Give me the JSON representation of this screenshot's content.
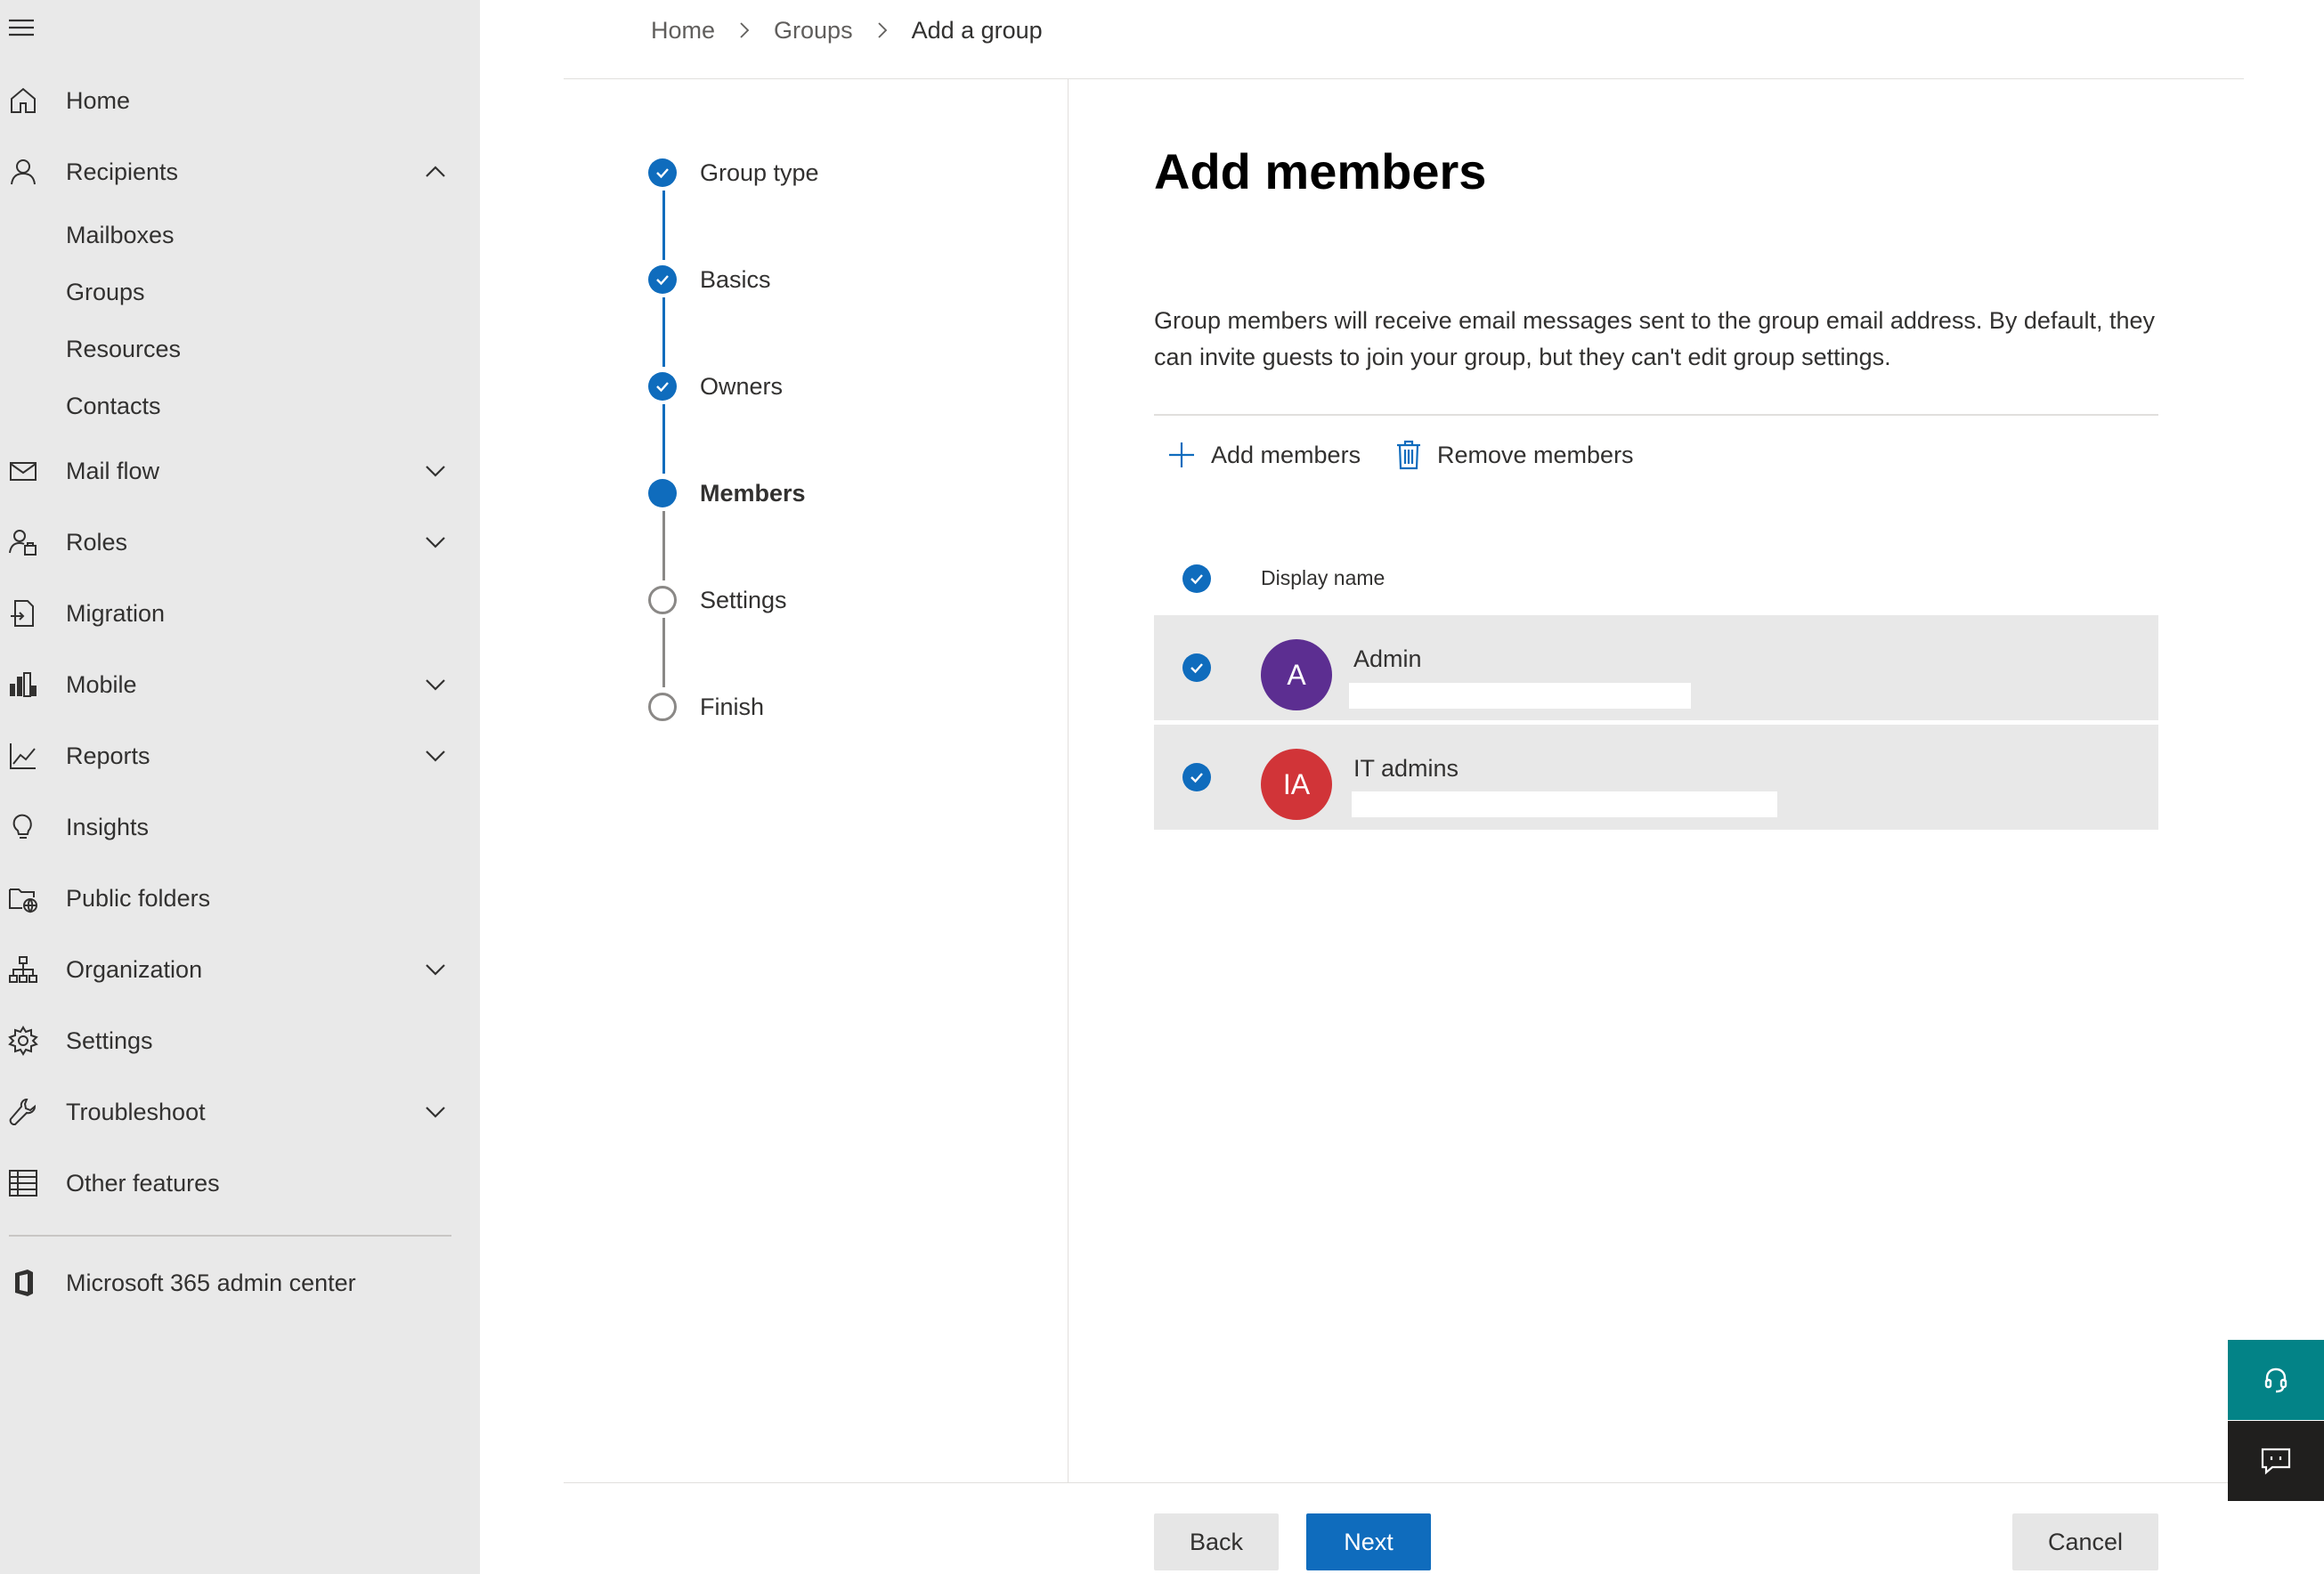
{
  "breadcrumb": {
    "items": [
      "Home",
      "Groups",
      "Add a group"
    ]
  },
  "sidebar": {
    "items": [
      {
        "label": "Home",
        "icon": "home-icon"
      },
      {
        "label": "Recipients",
        "icon": "person-icon",
        "expanded": true,
        "children": [
          "Mailboxes",
          "Groups",
          "Resources",
          "Contacts"
        ]
      },
      {
        "label": "Mail flow",
        "icon": "mail-icon"
      },
      {
        "label": "Roles",
        "icon": "roles-icon"
      },
      {
        "label": "Migration",
        "icon": "migration-icon"
      },
      {
        "label": "Mobile",
        "icon": "mobile-icon"
      },
      {
        "label": "Reports",
        "icon": "reports-icon"
      },
      {
        "label": "Insights",
        "icon": "lightbulb-icon"
      },
      {
        "label": "Public folders",
        "icon": "public-folder-icon"
      },
      {
        "label": "Organization",
        "icon": "organization-icon"
      },
      {
        "label": "Settings",
        "icon": "gear-icon"
      },
      {
        "label": "Troubleshoot",
        "icon": "wrench-icon"
      },
      {
        "label": "Other features",
        "icon": "table-icon"
      }
    ],
    "footer_link": "Microsoft 365 admin center"
  },
  "wizard": {
    "steps": [
      {
        "label": "Group type",
        "status": "done"
      },
      {
        "label": "Basics",
        "status": "done"
      },
      {
        "label": "Owners",
        "status": "done"
      },
      {
        "label": "Members",
        "status": "current"
      },
      {
        "label": "Settings",
        "status": "todo"
      },
      {
        "label": "Finish",
        "status": "todo"
      }
    ]
  },
  "main": {
    "title": "Add members",
    "description": "Group members will receive email messages sent to the group email address. By default, they can invite guests to join your group, but they can't edit group settings.",
    "add_members_label": "Add members",
    "remove_members_label": "Remove members",
    "column_header": "Display name",
    "members": [
      {
        "initials": "A",
        "name": "Admin",
        "avatar_color": "#5c2e91",
        "selected": true
      },
      {
        "initials": "IA",
        "name": "IT admins",
        "avatar_color": "#d13438",
        "selected": true
      }
    ]
  },
  "footer": {
    "back_label": "Back",
    "next_label": "Next",
    "cancel_label": "Cancel"
  },
  "colors": {
    "accent": "#0f6cbd",
    "sidebar_bg": "#e9e9e9",
    "teal": "#038387",
    "dark": "#201f1e"
  }
}
